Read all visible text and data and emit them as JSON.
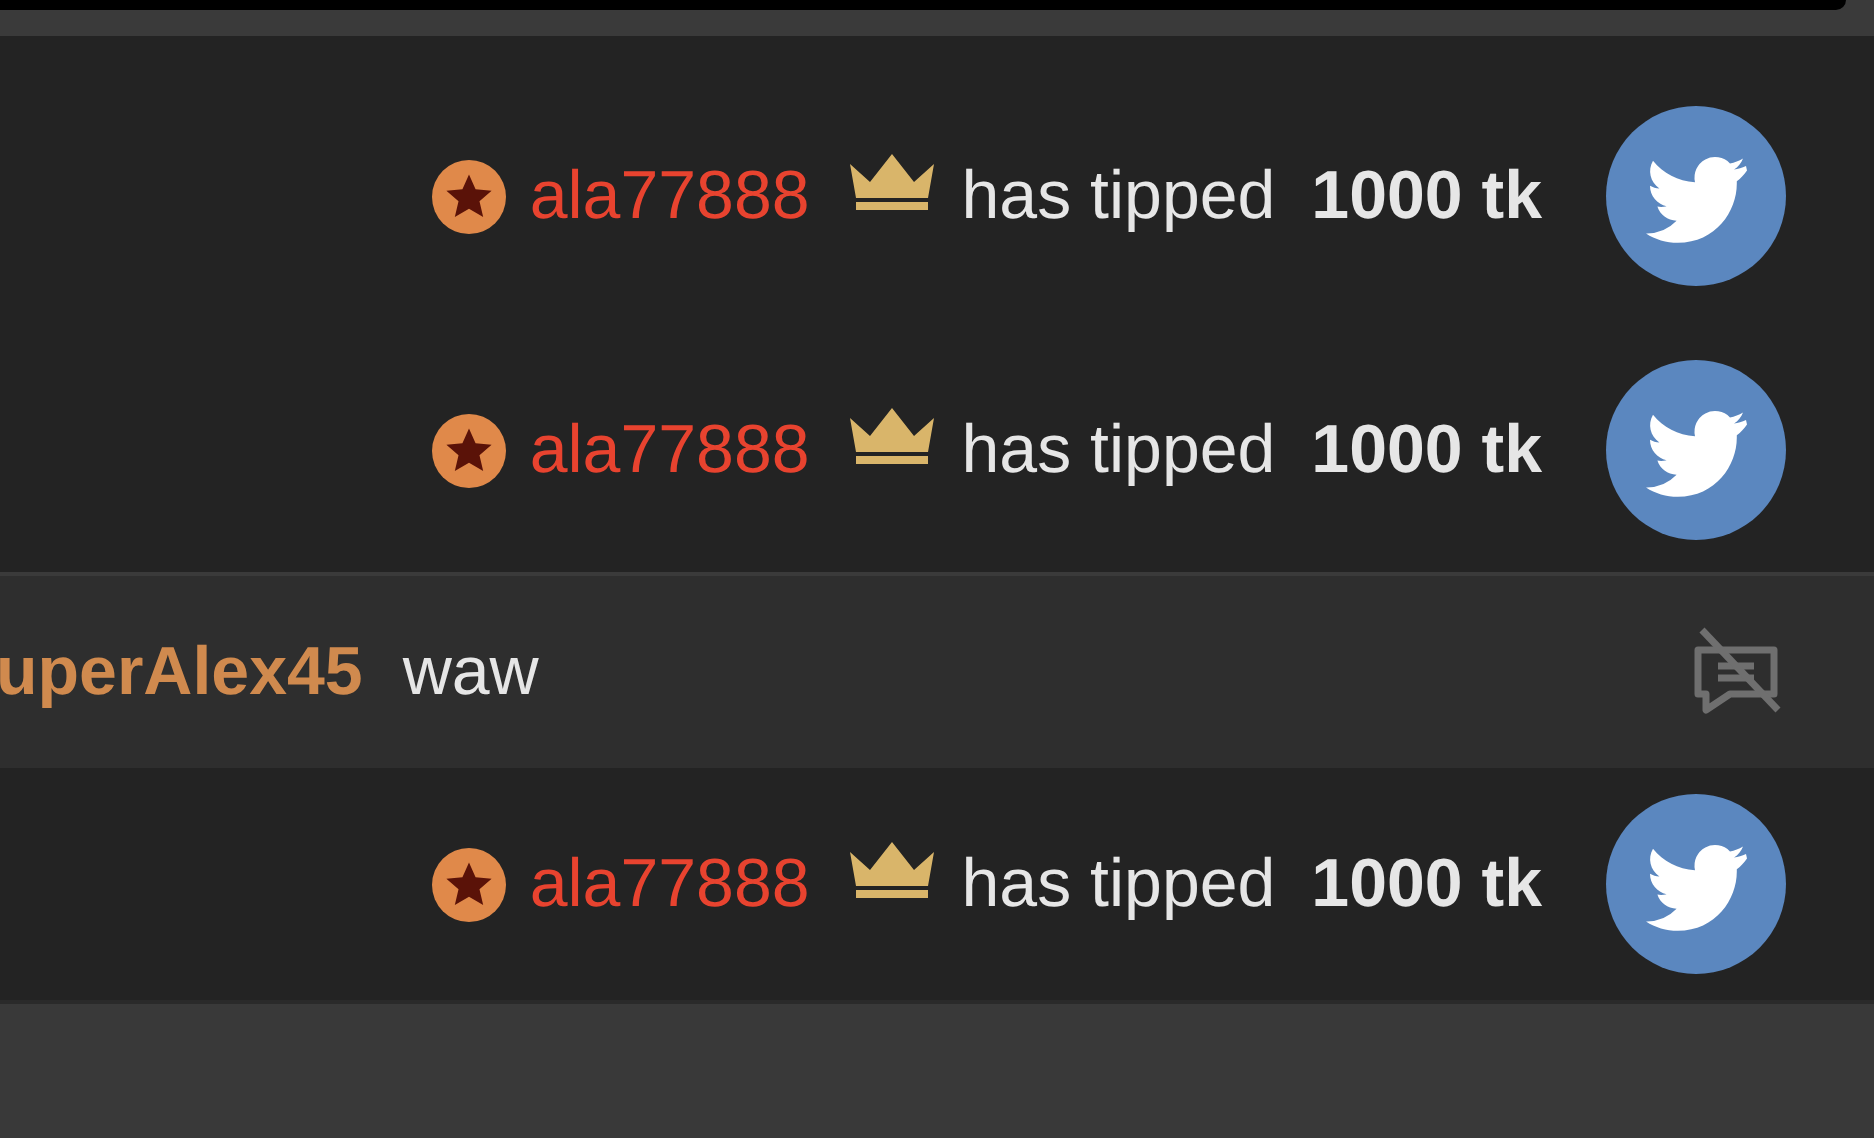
{
  "messages": [
    {
      "kind": "tip",
      "user": "ala77888",
      "action": "has tipped",
      "amount": "1000 tk"
    },
    {
      "kind": "tip",
      "user": "ala77888",
      "action": "has tipped",
      "amount": "1000 tk"
    },
    {
      "kind": "chat",
      "user": "uperAlex45",
      "text": "waw"
    },
    {
      "kind": "tip",
      "user": "ala77888",
      "action": "has tipped",
      "amount": "1000 tk"
    }
  ]
}
